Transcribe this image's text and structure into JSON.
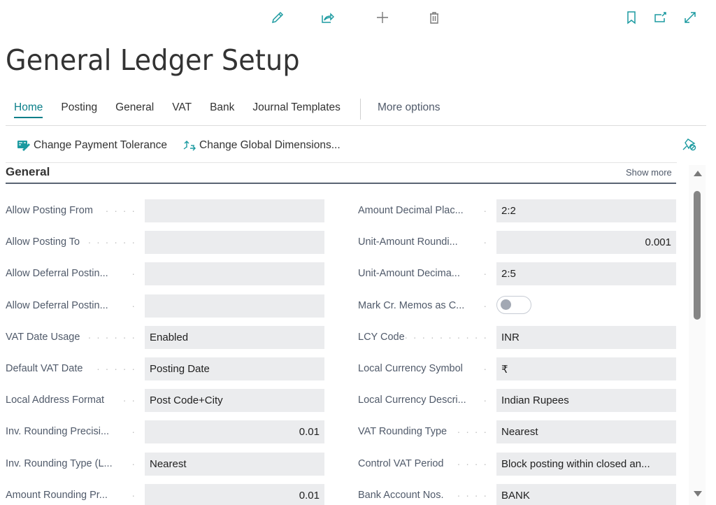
{
  "toolbar": {
    "icons": [
      "edit-icon",
      "share-icon",
      "new-icon",
      "delete-icon",
      "bookmark-icon",
      "open-new-window-icon",
      "expand-icon"
    ]
  },
  "page": {
    "title": "General Ledger Setup"
  },
  "tabs": [
    {
      "label": "Home",
      "active": true
    },
    {
      "label": "Posting"
    },
    {
      "label": "General"
    },
    {
      "label": "VAT"
    },
    {
      "label": "Bank"
    },
    {
      "label": "Journal Templates"
    }
  ],
  "more_options": "More options",
  "actions": [
    {
      "label": "Change Payment Tolerance",
      "icon": "payment-tolerance-icon"
    },
    {
      "label": "Change Global Dimensions...",
      "icon": "global-dimensions-icon"
    }
  ],
  "section": {
    "title": "General",
    "show_more": "Show more"
  },
  "left_fields": [
    {
      "label": "Allow Posting From",
      "value": "",
      "dots": "· · · ·"
    },
    {
      "label": "Allow Posting To",
      "value": "",
      "dots": "· · · · · ·"
    },
    {
      "label": "Allow Deferral Postin...",
      "value": "",
      "dots": "·"
    },
    {
      "label": "Allow Deferral Postin...",
      "value": "",
      "dots": "·"
    },
    {
      "label": "VAT Date Usage",
      "value": "Enabled",
      "dots": "· · · · · ·"
    },
    {
      "label": "Default VAT Date",
      "value": "Posting Date",
      "dots": "· · · · ·"
    },
    {
      "label": "Local Address Format",
      "value": "Post Code+City",
      "dots": "· ·"
    },
    {
      "label": "Inv. Rounding Precisi...",
      "value": "0.01",
      "dots": "·",
      "numeric": true
    },
    {
      "label": "Inv. Rounding Type (L...",
      "value": "Nearest",
      "dots": "·"
    },
    {
      "label": "Amount Rounding Pr...",
      "value": "0.01",
      "dots": "·",
      "numeric": true
    }
  ],
  "right_fields": [
    {
      "label": "Amount Decimal Plac...",
      "value": "2:2",
      "dots": "·"
    },
    {
      "label": "Unit-Amount Roundi...",
      "value": "0.001",
      "dots": "·",
      "numeric": true
    },
    {
      "label": "Unit-Amount Decima...",
      "value": "2:5",
      "dots": "·"
    },
    {
      "label": "Mark Cr. Memos as C...",
      "value": "",
      "dots": "·",
      "toggle": true,
      "toggle_on": false
    },
    {
      "label": "LCY Code",
      "value": "INR",
      "dots": "· · · · · · · · · · ·"
    },
    {
      "label": "Local Currency Symbol",
      "value": "₹",
      "dots": "·"
    },
    {
      "label": "Local Currency Descri...",
      "value": "Indian Rupees",
      "dots": "·"
    },
    {
      "label": "VAT Rounding Type",
      "value": "Nearest",
      "dots": "· · · ·"
    },
    {
      "label": "Control VAT Period",
      "value": "Block posting within closed an...",
      "dots": "· · · ·"
    },
    {
      "label": "Bank Account Nos.",
      "value": "BANK",
      "dots": "· · · ·"
    }
  ]
}
